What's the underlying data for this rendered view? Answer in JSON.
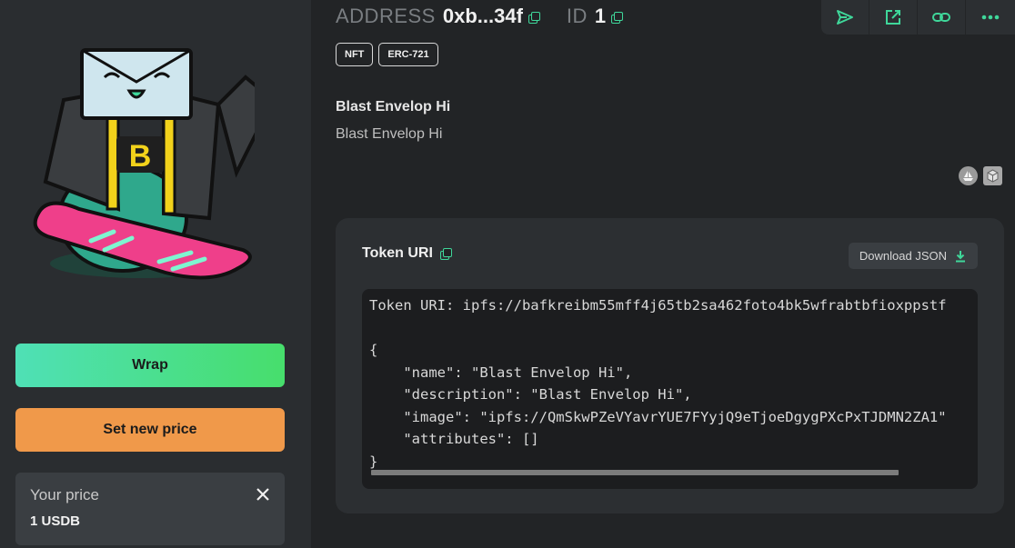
{
  "header": {
    "address_key": "ADDRESS",
    "address_value": "0xb...34f",
    "id_key": "ID",
    "id_value": "1"
  },
  "toolbar": {
    "icons": [
      "send-icon",
      "external-link-icon",
      "link-icon",
      "more-icon"
    ]
  },
  "tags": [
    "NFT",
    "ERC-721"
  ],
  "nft": {
    "title": "Blast Envelop Hi",
    "description": "Blast Envelop Hi"
  },
  "actions": {
    "wrap_label": "Wrap",
    "set_price_label": "Set new price"
  },
  "price": {
    "label": "Your price",
    "value": "1 USDB"
  },
  "token_uri": {
    "title": "Token URI",
    "download_label": "Download JSON",
    "lines": [
      "Token URI: ipfs://bafkreibm55mff4j65tb2sa462foto4bk5wfrabtbfioxppstf",
      "",
      "{",
      "    \"name\": \"Blast Envelop Hi\",",
      "    \"description\": \"Blast Envelop Hi\",",
      "    \"image\": \"ipfs://QmSkwPZeVYavrYUE7FYyjQ9eTjoeDgygPXcPxTJDMN2ZA1\"",
      "    \"attributes\": []",
      "}"
    ]
  },
  "colors": {
    "accent": "#3fd79a",
    "wrap_gradient_start": "#4fe0b6",
    "wrap_gradient_end": "#47de6c",
    "price_button": "#f0994a"
  }
}
